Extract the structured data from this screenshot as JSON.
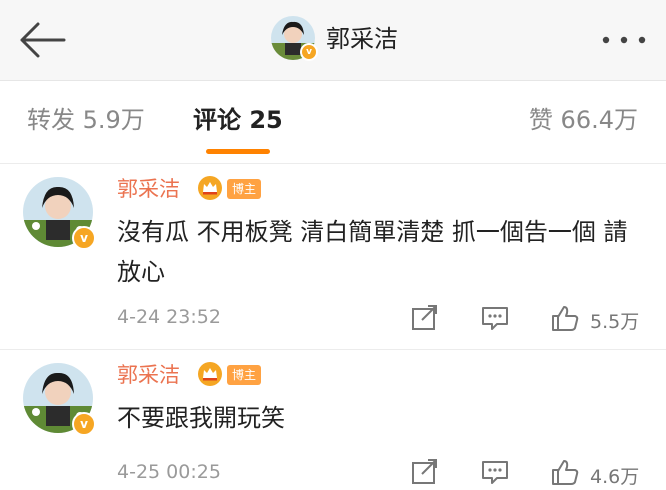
{
  "header": {
    "title": "郭采洁",
    "back_icon": "back-arrow-icon",
    "more_icon": "more-dots-icon"
  },
  "tabs": {
    "repost": "转发 5.9万",
    "comment": "评论 25",
    "like": "赞 66.4万",
    "active": "comment",
    "accent": "#ff8200"
  },
  "comments": [
    {
      "name": "郭采洁",
      "badge": "博主",
      "text": "沒有瓜 不用板凳 清白簡單清楚 抓一個告一個 請放心",
      "time": "4-24 23:52",
      "likes": "5.5万"
    },
    {
      "name": "郭采洁",
      "badge": "博主",
      "text": "不要跟我開玩笑",
      "time": "4-25 00:25",
      "likes": "4.6万"
    }
  ],
  "colors": {
    "username": "#eb7350",
    "badge_bg": "#ffa242",
    "meta": "#9a9a9a",
    "verified": "#f6a623"
  }
}
